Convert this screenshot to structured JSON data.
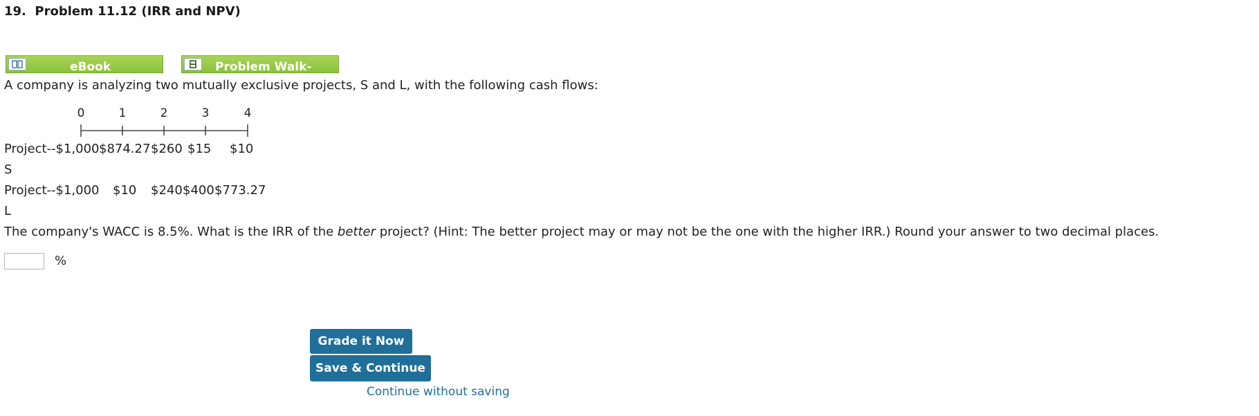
{
  "title": "19.  Problem 11.12 (IRR and NPV)",
  "resources": {
    "ebook_label": "eBook",
    "walkthrough_label": "Problem Walk-"
  },
  "question": {
    "intro": "A company is analyzing two mutually exclusive projects, S and L, with the following cash flows:",
    "timeline": [
      "0",
      "1",
      "2",
      "3",
      "4"
    ],
    "project_s": {
      "label": "Project-",
      "label2": "S",
      "cf": [
        "-$1,000",
        "$874.27",
        "$260",
        "$15",
        "$10"
      ]
    },
    "project_l": {
      "label": "Project-",
      "label2": "L",
      "cf": [
        "-$1,000",
        "$10",
        "$240",
        "$400",
        "$773.27"
      ]
    },
    "prompt_part1": "The company's WACC is 8.5%. What is the IRR of the ",
    "prompt_italic": "better",
    "prompt_part2": " project? (Hint: The better project may or may not be the one with the higher IRR.) Round your answer to two decimal places."
  },
  "answer": {
    "value": "",
    "unit": "%"
  },
  "actions": {
    "grade_label": "Grade it Now",
    "save_label": "Save & Continue",
    "continue_label": "Continue without saving"
  },
  "icons": {
    "ebook": "book-icon",
    "walkthrough": "film-icon"
  },
  "colors": {
    "accent": "#1f6f99",
    "resource_green": "#8bc13a"
  }
}
